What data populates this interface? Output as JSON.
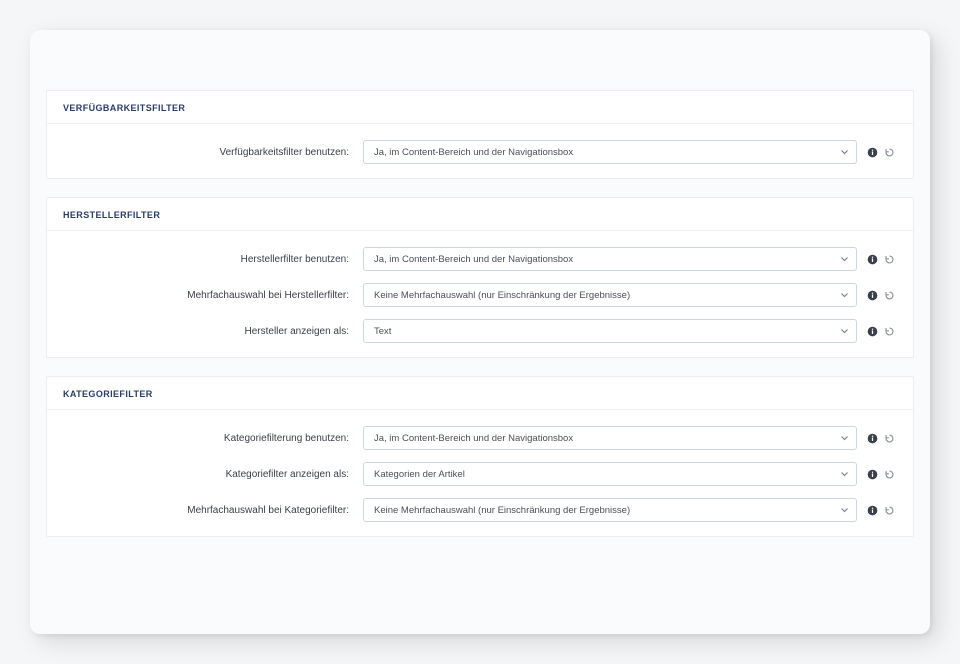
{
  "sections": [
    {
      "title": "VERFÜGBARKEITSFILTER",
      "rows": [
        {
          "label": "Verfügbarkeitsfilter benutzen:",
          "value": "Ja, im Content-Bereich und der Navigationsbox"
        }
      ]
    },
    {
      "title": "HERSTELLERFILTER",
      "rows": [
        {
          "label": "Herstellerfilter benutzen:",
          "value": "Ja, im Content-Bereich und der Navigationsbox"
        },
        {
          "label": "Mehrfachauswahl bei Herstellerfilter:",
          "value": "Keine Mehrfachauswahl (nur Einschränkung der Ergebnisse)"
        },
        {
          "label": "Hersteller anzeigen als:",
          "value": "Text"
        }
      ]
    },
    {
      "title": "KATEGORIEFILTER",
      "rows": [
        {
          "label": "Kategoriefilterung benutzen:",
          "value": "Ja, im Content-Bereich und der Navigationsbox"
        },
        {
          "label": "Kategoriefilter anzeigen als:",
          "value": "Kategorien der Artikel"
        },
        {
          "label": "Mehrfachauswahl bei Kategoriefilter:",
          "value": "Keine Mehrfachauswahl (nur Einschränkung der Ergebnisse)"
        }
      ]
    }
  ]
}
